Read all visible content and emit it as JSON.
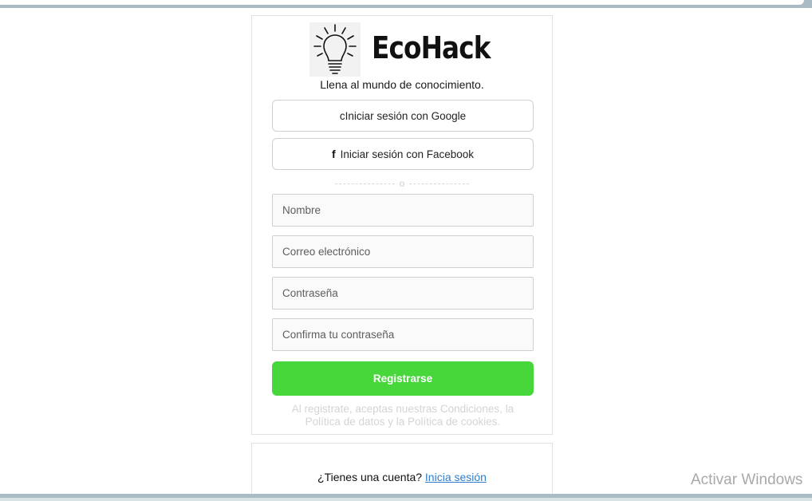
{
  "brand": {
    "name": "EcoHack",
    "tagline": "Llena al mundo de conocimiento."
  },
  "social": {
    "google_label": "cIniciar sesión con Google",
    "facebook_icon": "f",
    "facebook_label": "Iniciar sesión con Facebook"
  },
  "separator": {
    "text": "o"
  },
  "form": {
    "name_placeholder": "Nombre",
    "email_placeholder": "Correo electrónico",
    "password_placeholder": "Contraseña",
    "confirm_placeholder": "Confirma tu contraseña",
    "submit_label": "Registrarse",
    "legal_text": "Al registrate, aceptas nuestras Condiciones, la Política de datos y la Política de cookies."
  },
  "login": {
    "prompt": "¿Tienes una cuenta?",
    "link_label": "Inicia sesión"
  },
  "system": {
    "watermark": "Activar Windows"
  },
  "colors": {
    "accent_green": "#48d73b",
    "link_blue": "#2f7fd0",
    "frame": "#a9bcc3"
  },
  "icons": {
    "logo": "lightbulb-icon",
    "facebook": "facebook-icon"
  }
}
